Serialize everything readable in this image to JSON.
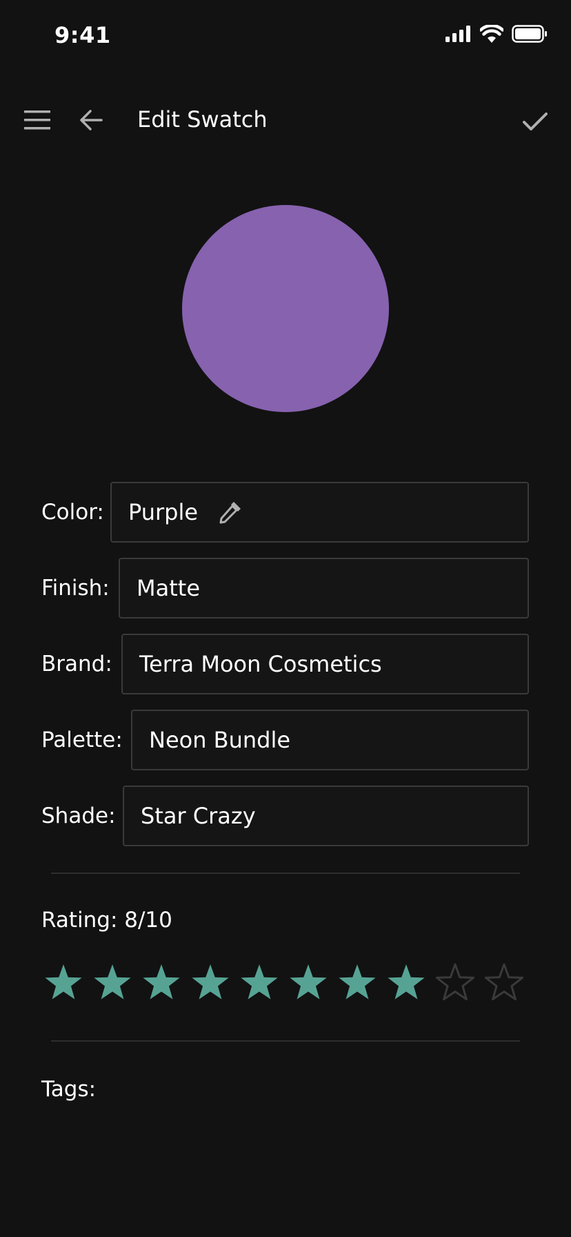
{
  "status_bar": {
    "time": "9:41"
  },
  "app_bar": {
    "title": "Edit Swatch",
    "menu_icon": "hamburger-menu-icon",
    "back_icon": "arrow-left-icon",
    "save_icon": "checkmark-icon"
  },
  "swatch": {
    "color_hex": "#8762AF"
  },
  "fields": {
    "color": {
      "label": "Color:",
      "value": "Purple",
      "icon": "eyedropper-icon"
    },
    "finish": {
      "label": "Finish:",
      "value": "Matte"
    },
    "brand": {
      "label": "Brand:",
      "value": "Terra Moon Cosmetics"
    },
    "palette": {
      "label": "Palette:",
      "value": "Neon Bundle"
    },
    "shade": {
      "label": "Shade:",
      "value": "Star Crazy"
    }
  },
  "rating": {
    "label": "Rating: 8/10",
    "value": 8,
    "max": 10,
    "filled_color": "#56A394",
    "empty_color": "#3A3A3A"
  },
  "tags": {
    "label": "Tags:"
  },
  "colors": {
    "background": "#121212",
    "field_border": "#3A3A3A",
    "icon_gray": "#B0B0B0"
  }
}
